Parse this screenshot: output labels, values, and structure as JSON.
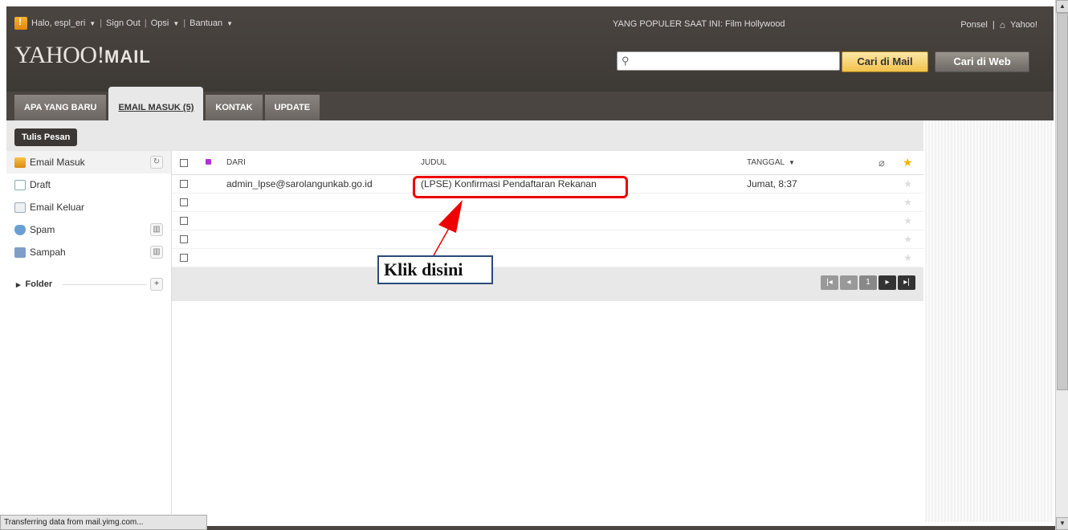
{
  "topbar": {
    "greeting": "Halo, espl_eri",
    "sign_out": "Sign Out",
    "options": "Opsi",
    "help": "Bantuan",
    "popular": "YANG POPULER SAAT INI: Film Hollywood",
    "mobile": "Ponsel",
    "yahoo": "Yahoo!"
  },
  "logo": {
    "brand": "YAHOO!",
    "product": "MAIL"
  },
  "search": {
    "placeholder": "",
    "mail_button": "Cari di Mail",
    "web_button": "Cari di Web"
  },
  "tabs": [
    {
      "label": "APA YANG BARU"
    },
    {
      "label": "EMAIL MASUK (5)"
    },
    {
      "label": "KONTAK"
    },
    {
      "label": "UPDATE"
    }
  ],
  "toolbar": {
    "compose": "Tulis Pesan"
  },
  "sidebar": {
    "items": [
      {
        "label": "Email Masuk",
        "icon": "inbox-icon"
      },
      {
        "label": "Draft",
        "icon": "draft-icon"
      },
      {
        "label": "Email Keluar",
        "icon": "outbox-icon"
      },
      {
        "label": "Spam",
        "icon": "spam-icon"
      },
      {
        "label": "Sampah",
        "icon": "trash-icon"
      }
    ],
    "folder": "Folder"
  },
  "list": {
    "headers": {
      "from": "DARI",
      "subject": "JUDUL",
      "date": "TANGGAL"
    },
    "rows": [
      {
        "from": "admin_lpse@sarolangunkab.go.id",
        "subject": "(LPSE) Konfirmasi Pendaftaran Rekanan",
        "date": "Jumat, 8:37"
      }
    ],
    "page": "1"
  },
  "annotation": {
    "callout": "Klik disini"
  },
  "status": {
    "text": "Transferring data from mail.yimg.com..."
  },
  "colors": {
    "header": "#4a4541",
    "highlight": "#ee0000",
    "accent": "#f2c24b"
  }
}
